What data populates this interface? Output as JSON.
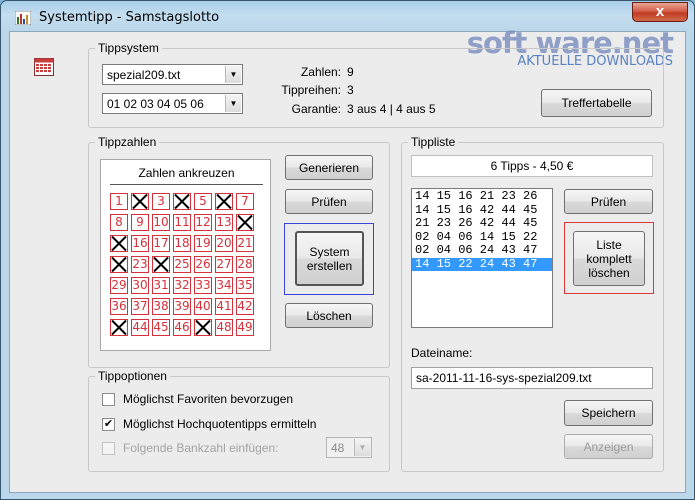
{
  "window": {
    "title": "Systemtipp - Samstagslotto",
    "close_label": "x"
  },
  "watermark": {
    "brand": "soft ware.net",
    "tagline": "AKTUELLE DOWNLOADS"
  },
  "tippsystem": {
    "group_label": "Tippsystem",
    "file_select": "spezial209.txt",
    "numbers_select": "01 02 03 04 05 06",
    "zahlen_label": "Zahlen:",
    "zahlen_value": "9",
    "tippreihen_label": "Tippreihen:",
    "tippreihen_value": "3",
    "garantie_label": "Garantie:",
    "garantie_value": "3 aus 4 | 4 aus 5",
    "treffer_button": "Treffertabelle"
  },
  "tippzahlen": {
    "group_label": "Tippzahlen",
    "grid_header": "Zahlen ankreuzen",
    "numbers": [
      "1",
      "2",
      "3",
      "4",
      "5",
      "6",
      "7",
      "8",
      "9",
      "10",
      "11",
      "12",
      "13",
      "14",
      "15",
      "16",
      "17",
      "18",
      "19",
      "20",
      "21",
      "22",
      "23",
      "24",
      "25",
      "26",
      "27",
      "28",
      "29",
      "30",
      "31",
      "32",
      "33",
      "34",
      "35",
      "36",
      "37",
      "38",
      "39",
      "40",
      "41",
      "42",
      "43",
      "44",
      "45",
      "46",
      "47",
      "48",
      "49"
    ],
    "crossed": [
      "2",
      "4",
      "6",
      "14",
      "15",
      "22",
      "24",
      "43",
      "47"
    ],
    "generieren_button": "Generieren",
    "pruefen_button": "Prüfen",
    "system_button": "System erstellen",
    "loeschen_button": "Löschen"
  },
  "tippoptionen": {
    "group_label": "Tippoptionen",
    "option1": "Möglichst Favoriten bevorzugen",
    "option1_checked": false,
    "option2": "Möglichst Hochquotentipps ermitteln",
    "option2_checked": true,
    "option3": "Folgende Bankzahl einfügen:",
    "option3_checked": false,
    "bankzahl": "48"
  },
  "tippliste": {
    "group_label": "Tippliste",
    "summary": "6 Tipps - 4,50 €",
    "items": [
      "14 15 16 21 23 26",
      "14 15 16 42 44 45",
      "21 23 26 42 44 45",
      "02 04 06 14 15 22",
      "02 04 06 24 43 47",
      "14 15 22 24 43 47"
    ],
    "selected_index": 5,
    "pruefen_button": "Prüfen",
    "loeschen_button": "Liste komplett löschen",
    "dateiname_label": "Dateiname:",
    "dateiname_value": "sa-2011-11-16-sys-spezial209.txt",
    "speichern_button": "Speichern",
    "anzeigen_button": "Anzeigen"
  }
}
